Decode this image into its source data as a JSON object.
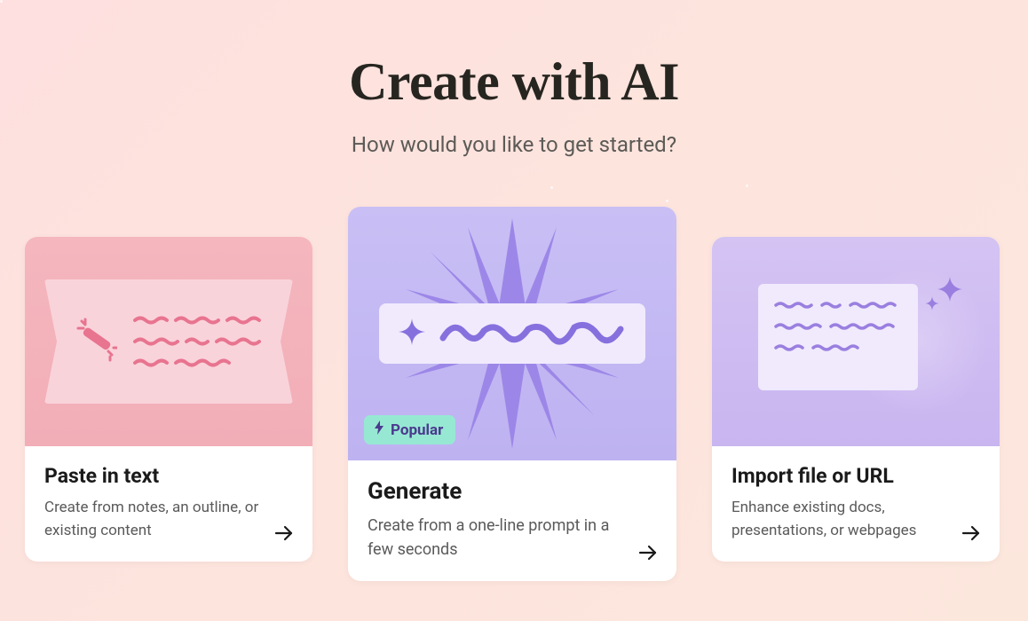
{
  "header": {
    "title": "Create with AI",
    "subtitle": "How would you like to get started?"
  },
  "cards": {
    "paste": {
      "title": "Paste in text",
      "description": "Create from notes, an outline, or existing content"
    },
    "generate": {
      "title": "Generate",
      "description": "Create from a one-line prompt in a few seconds",
      "badge": "Popular"
    },
    "import": {
      "title": "Import file or URL",
      "description": "Enhance existing docs, presentations, or webpages"
    }
  }
}
